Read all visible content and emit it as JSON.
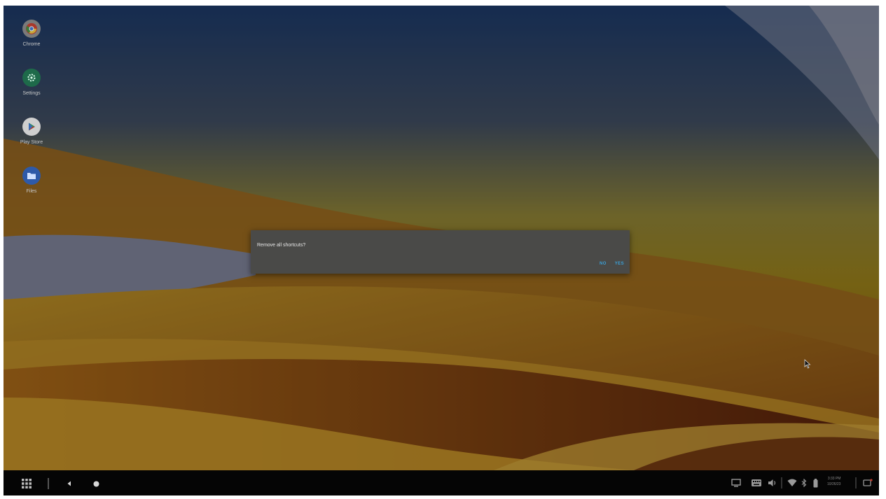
{
  "desktop": {
    "shortcuts": [
      {
        "label": "Chrome",
        "icon": "chrome-icon"
      },
      {
        "label": "Settings",
        "icon": "settings-gear-icon"
      },
      {
        "label": "Play Store",
        "icon": "play-store-icon"
      },
      {
        "label": "Files",
        "icon": "files-folder-icon"
      }
    ]
  },
  "dialog": {
    "message": "Remove all shortcuts?",
    "no_label": "NO",
    "yes_label": "YES",
    "button_color": "#3ba0d8"
  },
  "taskbar": {
    "left_icons": [
      "app-drawer-icon",
      "back-icon",
      "home-icon"
    ],
    "tray_icons": [
      "screencast-icon",
      "keyboard-icon",
      "volume-icon",
      "wifi-icon",
      "bluetooth-icon",
      "battery-icon",
      "notification-icon"
    ],
    "clock_time": "3:33 PM",
    "clock_date": "10/26/23"
  }
}
